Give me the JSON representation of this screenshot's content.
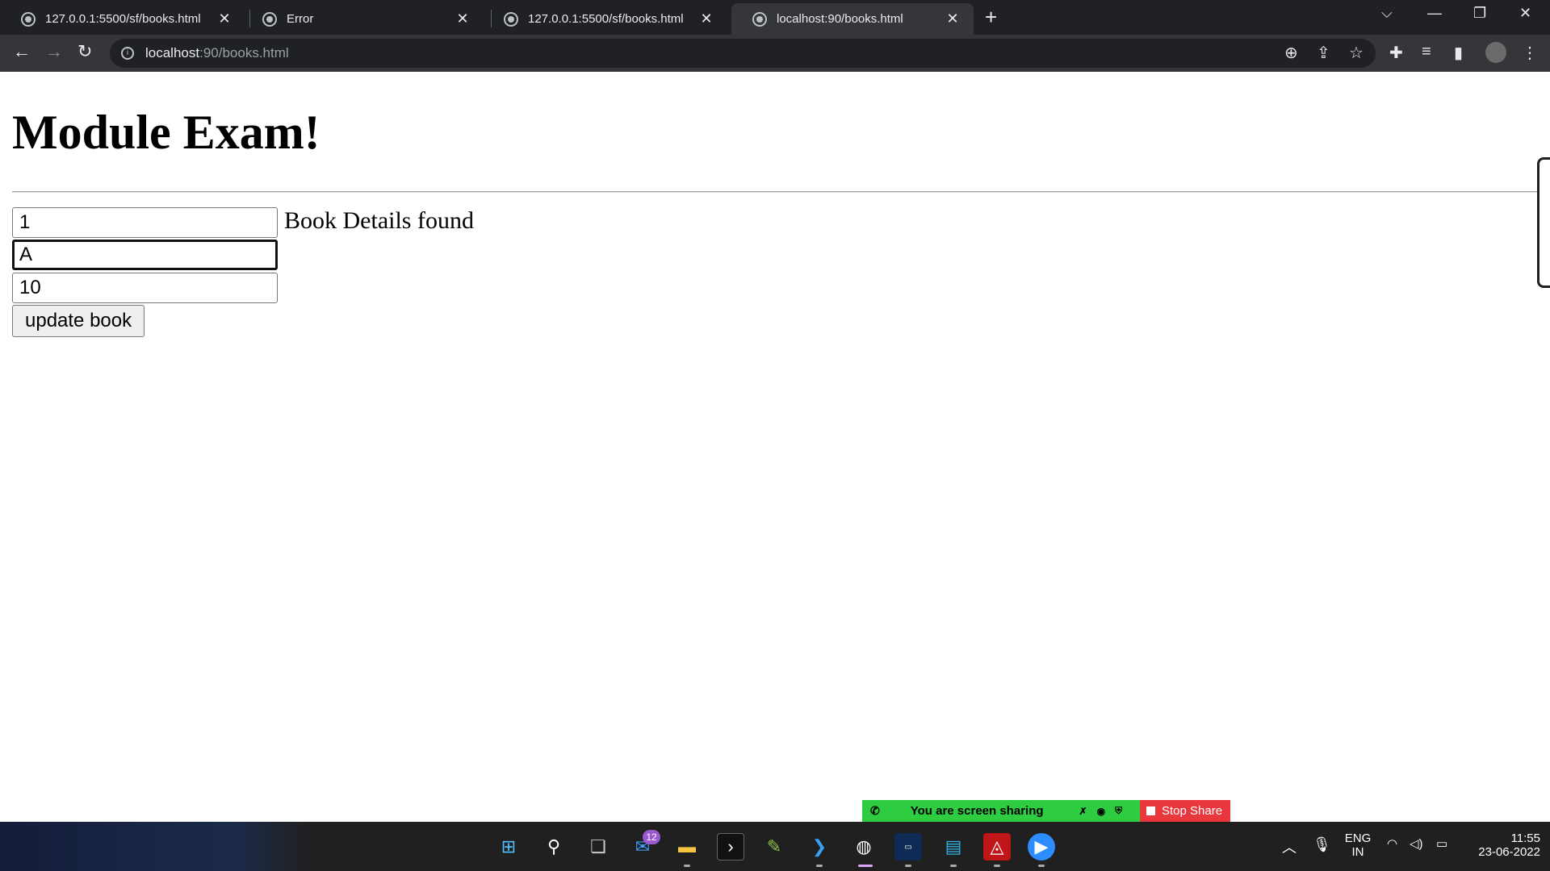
{
  "browser": {
    "tabs": [
      {
        "title": "127.0.0.1:5500/sf/books.html"
      },
      {
        "title": "Error"
      },
      {
        "title": "127.0.0.1:5500/sf/books.html"
      },
      {
        "title": "localhost:90/books.html"
      }
    ],
    "active_tab_index": 3,
    "address": {
      "host": "localhost",
      "path": ":90/books.html"
    }
  },
  "page": {
    "heading": "Module Exam!",
    "fields": {
      "id": "1",
      "name": "A",
      "price": "10"
    },
    "status": "Book Details found",
    "update_button": "update book"
  },
  "screen_share": {
    "message": "You are screen sharing",
    "stop_label": "Stop Share"
  },
  "taskbar": {
    "mail_badge": "12",
    "lang_line1": "ENG",
    "lang_line2": "IN",
    "time": "11:55",
    "date": "23-06-2022"
  },
  "colors": {
    "share_green": "#2ecc40",
    "stop_red": "#e8383d",
    "chrome_dark": "#202124"
  }
}
